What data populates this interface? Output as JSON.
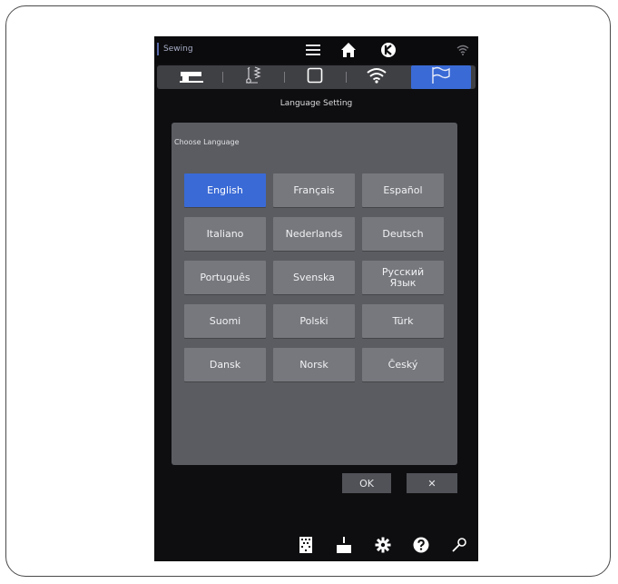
{
  "app": {
    "mode_label": "Sewing"
  },
  "header": {
    "menu_icon": "menu-icon",
    "home_icon": "home-icon",
    "brand_icon": "brand-logo-icon",
    "wifi_icon": "wifi-status-icon"
  },
  "tabs": [
    {
      "icon": "sewing-machine-icon",
      "active": false
    },
    {
      "icon": "stitch-settings-icon",
      "active": false
    },
    {
      "icon": "screen-settings-icon",
      "active": false
    },
    {
      "icon": "wifi-icon",
      "active": false
    },
    {
      "icon": "flag-icon",
      "active": true
    }
  ],
  "page": {
    "title": "Language Setting"
  },
  "panel": {
    "label": "Choose Language"
  },
  "languages": [
    "English",
    "Français",
    "Español",
    "Italiano",
    "Nederlands",
    "Deutsch",
    "Português",
    "Svenska",
    "Русский\nЯзык",
    "Suomi",
    "Polski",
    "Türk",
    "Dansk",
    "Norsk",
    "Český"
  ],
  "selected_language": "English",
  "actions": {
    "ok_label": "OK",
    "cancel_label": "✕"
  },
  "bottom_bar": [
    "stitch-density-icon",
    "needle-down-icon",
    "settings-gear-icon",
    "help-icon",
    "wrench-icon"
  ],
  "colors": {
    "accent": "#3a6ad6",
    "button": "#76787d",
    "panel": "#5a5c61",
    "screen": "#0e0e10"
  }
}
